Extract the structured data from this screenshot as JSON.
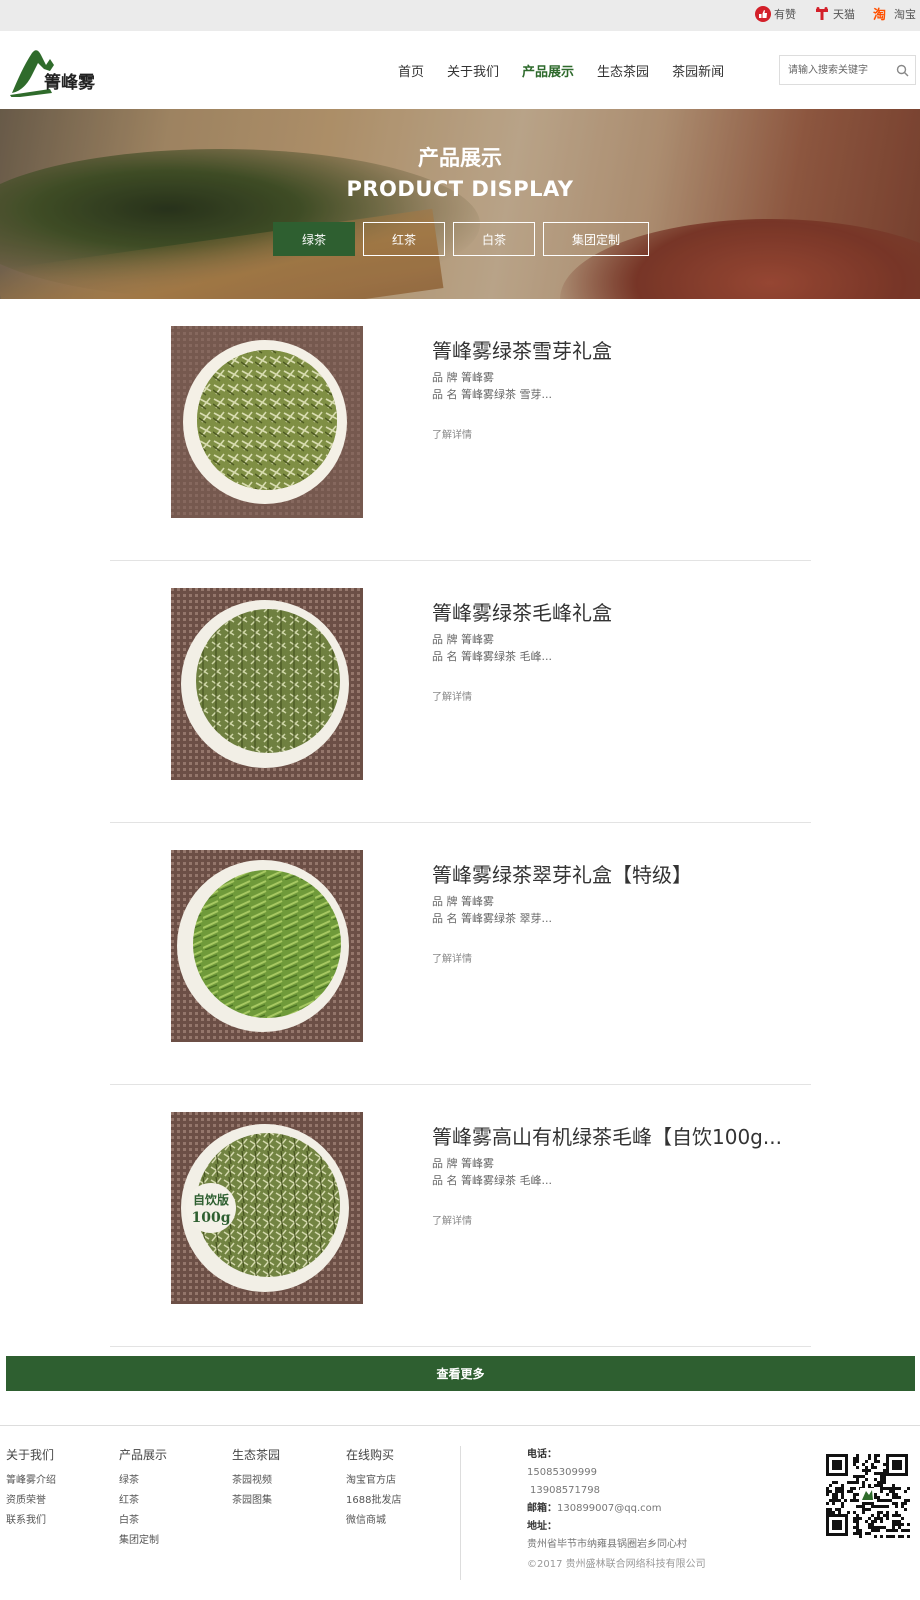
{
  "topbar": {
    "links": [
      {
        "label": "有赞",
        "icon": "youzan-icon"
      },
      {
        "label": "天猫",
        "icon": "tmall-icon"
      },
      {
        "label": "淘宝",
        "icon": "taobao-icon"
      }
    ]
  },
  "header": {
    "logo_text": "箐峰雾",
    "nav": [
      "首页",
      "关于我们",
      "产品展示",
      "生态茶园",
      "茶园新闻"
    ],
    "active_nav": "产品展示",
    "search_placeholder": "请输入搜索关键字"
  },
  "banner": {
    "title_cn": "产品展示",
    "title_en": "PRODUCT DISPLAY",
    "tabs": [
      "绿茶",
      "红茶",
      "白茶",
      "集团定制"
    ],
    "active_tab": "绿茶"
  },
  "products": [
    {
      "title": "箐峰雾绿茶雪芽礼盒",
      "brand": "品 牌 箐峰雾",
      "name": "品 名 箐峰雾绿茶 雪芽...",
      "more": "了解详情"
    },
    {
      "title": "箐峰雾绿茶毛峰礼盒",
      "brand": "品 牌 箐峰雾",
      "name": "品 名 箐峰雾绿茶 毛峰...",
      "more": "了解详情"
    },
    {
      "title": "箐峰雾绿茶翠芽礼盒【特级】",
      "brand": "品 牌 箐峰雾",
      "name": "品 名 箐峰雾绿茶 翠芽...",
      "more": "了解详情"
    },
    {
      "title": "箐峰雾高山有机绿茶毛峰【自饮100g...",
      "brand": "品 牌 箐峰雾",
      "name": "品 名 箐峰雾绿茶 毛峰...",
      "more": "了解详情",
      "badge_line1": "自饮版",
      "badge_line2": "100g"
    }
  ],
  "more_button": "查看更多",
  "footer": {
    "columns": [
      {
        "head": "关于我们",
        "links": [
          "箐峰雾介绍",
          "资质荣誉",
          "联系我们"
        ]
      },
      {
        "head": "产品展示",
        "links": [
          "绿茶",
          "红茶",
          "白茶",
          "集团定制"
        ]
      },
      {
        "head": "生态茶园",
        "links": [
          "茶园视频",
          "茶园图集"
        ]
      },
      {
        "head": "在线购买",
        "links": [
          "淘宝官方店",
          "1688批发店",
          "微信商城"
        ]
      }
    ],
    "contact": {
      "phone_label": "电话：",
      "phone1": "15085309999",
      "phone2": "13908571798",
      "email_label": "邮箱：",
      "email": "130899007@qq.com",
      "address_label": "地址：",
      "address": "贵州省毕节市纳雍县锅圈岩乡同心村"
    },
    "copyright": "©2017 贵州盛林联合网络科技有限公司"
  },
  "colors": {
    "brand_green": "#2e5f30",
    "active_nav": "#2e6a2c"
  }
}
